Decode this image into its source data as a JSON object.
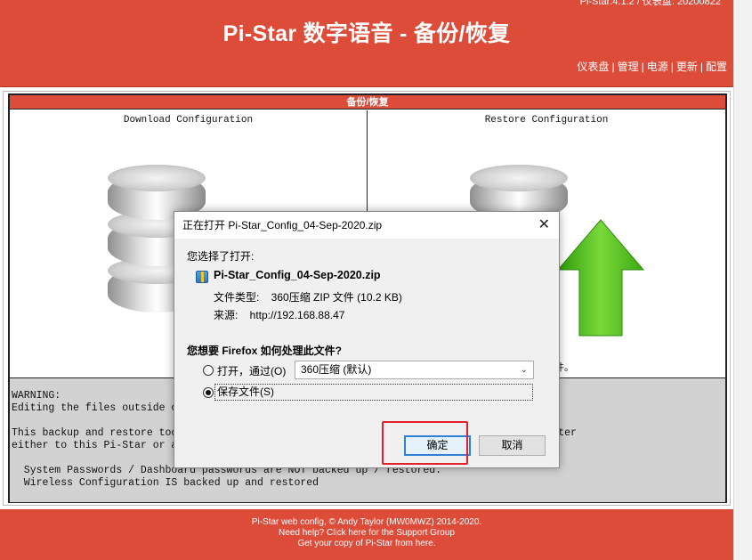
{
  "header": {
    "top_info": "Pi-Star:4.1.2 / 仪表盘: 20200822",
    "title": "Pi-Star 数字语音 - 备份/恢复",
    "nav": [
      "仪表盘",
      "管理",
      "电源",
      "更新",
      "配置"
    ]
  },
  "panel": {
    "header": "备份/恢复",
    "left_title": "Download Configuration",
    "right_title": "Restore Configuration",
    "right_hidden_tail": "件。"
  },
  "warning": {
    "lines": [
      "WARNING:",
      "Editing the files outside o",
      "",
      "This backup and restore too                                            to restore them later",
      "either to this Pi-Star or a",
      "",
      "  System Passwords / Dashboard passwords are NOT backed up / restored.",
      "  Wireless Configuration IS backed up and restored"
    ]
  },
  "footer": {
    "line1": "Pi-Star web config, © Andy Taylor (MW0MWZ) 2014-2020.",
    "line2": "Need help? Click here for the Support Group",
    "line3": "Get your copy of Pi-Star from here."
  },
  "dialog": {
    "title": "正在打开 Pi-Star_Config_04-Sep-2020.zip",
    "close_glyph": "✕",
    "chosen_label": "您选择了打开:",
    "filename": "Pi-Star_Config_04-Sep-2020.zip",
    "type_line": "文件类型:    360压缩 ZIP 文件 (10.2 KB)",
    "source_line": "来源:    http://192.168.88.47",
    "question": "您想要 Firefox 如何处理此文件?",
    "open_with_label": "打开，通过(O)",
    "open_with_app": "360压缩 (默认)",
    "save_label": "保存文件(S)",
    "save_selected": true,
    "ok_label": "确定",
    "cancel_label": "取消"
  },
  "colors": {
    "brand_red": "#dd4b39",
    "highlight_red": "#e0202a",
    "arrow_green": "#4cbb17"
  }
}
